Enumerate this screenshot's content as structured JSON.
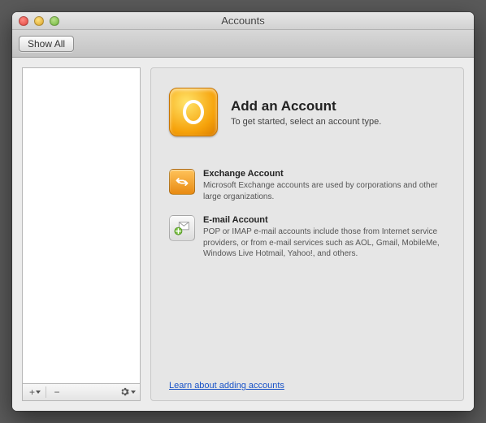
{
  "window": {
    "title": "Accounts"
  },
  "toolbar": {
    "show_all": "Show All"
  },
  "sidebar": {
    "add_label": "+",
    "remove_label": "–",
    "gear_label": "✻"
  },
  "main": {
    "hero": {
      "title": "Add an Account",
      "subtitle": "To get started, select an account type."
    },
    "options": [
      {
        "title": "Exchange Account",
        "desc": "Microsoft Exchange accounts are used by corporations and other large organizations."
      },
      {
        "title": "E-mail Account",
        "desc": "POP or IMAP e-mail accounts include those from Internet service providers, or from e-mail services such as AOL, Gmail, MobileMe, Windows Live Hotmail, Yahoo!, and others."
      }
    ],
    "learn_link": "Learn about adding accounts"
  }
}
